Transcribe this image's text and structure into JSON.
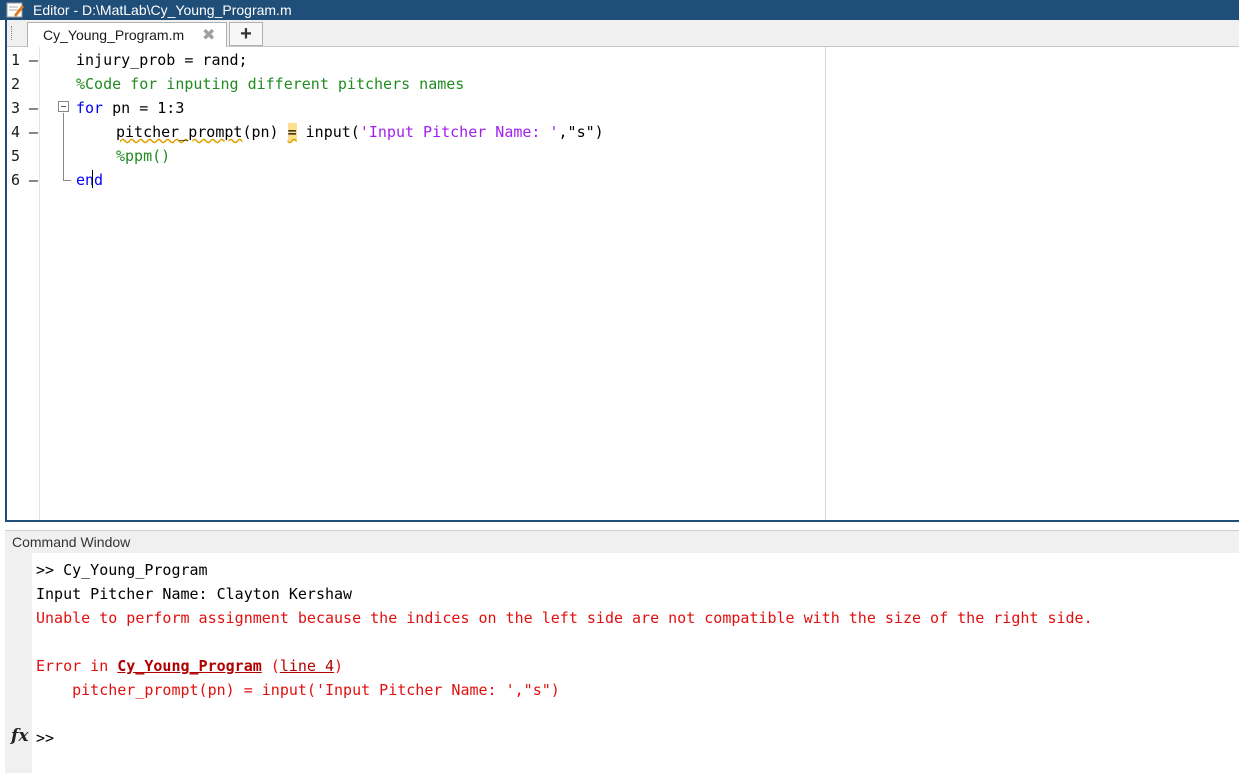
{
  "window": {
    "title": "Editor - D:\\MatLab\\Cy_Young_Program.m"
  },
  "editor": {
    "tab_label": "Cy_Young_Program.m",
    "tab_close_glyph": "✖",
    "add_tab_glyph": "+",
    "line_numbers": [
      "1 –",
      "2",
      "3 –",
      "4 –",
      "5",
      "6 –"
    ],
    "lines": {
      "l1": "injury_prob = rand;",
      "l2": "%Code for inputing different pitchers names",
      "l3_kw": "for",
      "l3_rest": " pn = 1:3",
      "l4_var": "pitcher_prompt",
      "l4_mid": "(pn) ",
      "l4_eq": "=",
      "l4_fn": " input(",
      "l4_str": "'Input Pitcher Name: '",
      "l4_end": ",\"s\")",
      "l5": "%ppm()",
      "l6": "end"
    }
  },
  "command_window": {
    "title": "Command Window",
    "lines": {
      "c1": ">> Cy_Young_Program",
      "c2": "Input Pitcher Name: Clayton Kershaw",
      "c3": "Unable to perform assignment because the indices on the left side are not compatible with the size of the right side.",
      "c4_prefix": "Error in ",
      "c4_link": "Cy_Young_Program",
      "c4_open": " (",
      "c4_line": "line 4",
      "c4_close": ")",
      "c5": "    pitcher_prompt(pn) = input('Input Pitcher Name: ',\"s\")",
      "prompt": ">>"
    },
    "fx_label": "fx"
  }
}
